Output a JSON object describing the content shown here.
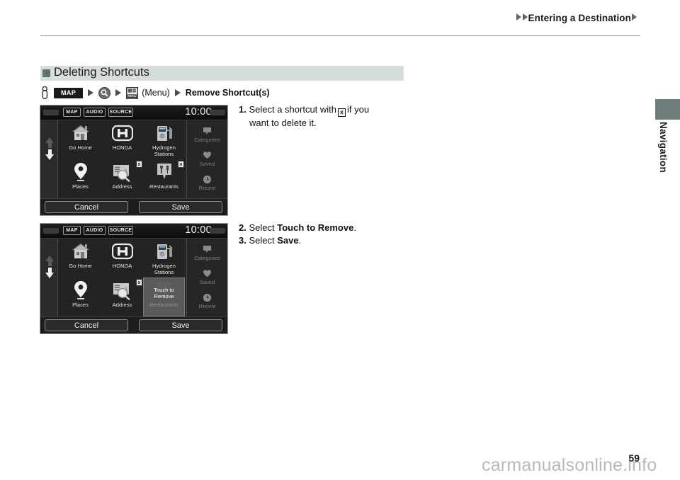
{
  "header": {
    "breadcrumb": "Entering a Destination"
  },
  "side_tab": {
    "label": "Navigation"
  },
  "section": {
    "title": "Deleting Shortcuts",
    "path": {
      "map_button": "MAP",
      "menu_paren": "(Menu)",
      "final": "Remove Shortcut(s)"
    }
  },
  "nav_screens": [
    {
      "topbar": {
        "map": "MAP",
        "audio": "AUDIO",
        "source": "SOURCE",
        "clock": "10:00"
      },
      "shortcuts": [
        {
          "label": "Go Home",
          "icon": "house-icon",
          "badge": null
        },
        {
          "label": "HONDA",
          "icon": "honda-h-icon",
          "badge": null
        },
        {
          "label": "Hydrogen\nStations",
          "icon": "fuel-pump-icon",
          "badge": null
        },
        {
          "label": "Places",
          "icon": "map-pin-icon",
          "badge": null
        },
        {
          "label": "Address",
          "icon": "address-icon",
          "badge": "x"
        },
        {
          "label": "Restaurants",
          "icon": "restaurant-icon",
          "badge": "x"
        }
      ],
      "side_items": [
        {
          "label": "Categories",
          "icon": "speech-bubble-icon"
        },
        {
          "label": "Saved",
          "icon": "heart-icon"
        },
        {
          "label": "Recent",
          "icon": "clock-icon"
        }
      ],
      "footer": {
        "cancel": "Cancel",
        "save": "Save"
      },
      "overlay": null
    },
    {
      "topbar": {
        "map": "MAP",
        "audio": "AUDIO",
        "source": "SOURCE",
        "clock": "10:00"
      },
      "shortcuts": [
        {
          "label": "Go Home",
          "icon": "house-icon",
          "badge": null
        },
        {
          "label": "HONDA",
          "icon": "honda-h-icon",
          "badge": null
        },
        {
          "label": "Hydrogen\nStations",
          "icon": "fuel-pump-icon",
          "badge": null
        },
        {
          "label": "Places",
          "icon": "map-pin-icon",
          "badge": null
        },
        {
          "label": "Address",
          "icon": "address-icon",
          "badge": "x"
        },
        {
          "label": "Restaurants",
          "icon": "restaurant-icon",
          "badge": null
        }
      ],
      "side_items": [
        {
          "label": "Categories",
          "icon": "speech-bubble-icon"
        },
        {
          "label": "Saved",
          "icon": "heart-icon"
        },
        {
          "label": "Recent",
          "icon": "clock-icon"
        }
      ],
      "footer": {
        "cancel": "Cancel",
        "save": "Save"
      },
      "overlay": {
        "line1": "Touch to",
        "line2": "Remove",
        "dimmed_label": "Restaurants"
      }
    }
  ],
  "steps": {
    "step1_num": "1.",
    "step1_pre": "Select a shortcut with",
    "step1_badge": "x",
    "step1_post": "if you",
    "step1_cont": "want to delete it.",
    "step2_num": "2.",
    "step2_pre": "Select",
    "step2_bold": "Touch to Remove",
    "step2_post": ".",
    "step3_num": "3.",
    "step3_pre": "Select",
    "step3_bold": "Save",
    "step3_post": "."
  },
  "footer": {
    "watermark": "carmanualsonline.info",
    "page_number": "59"
  }
}
